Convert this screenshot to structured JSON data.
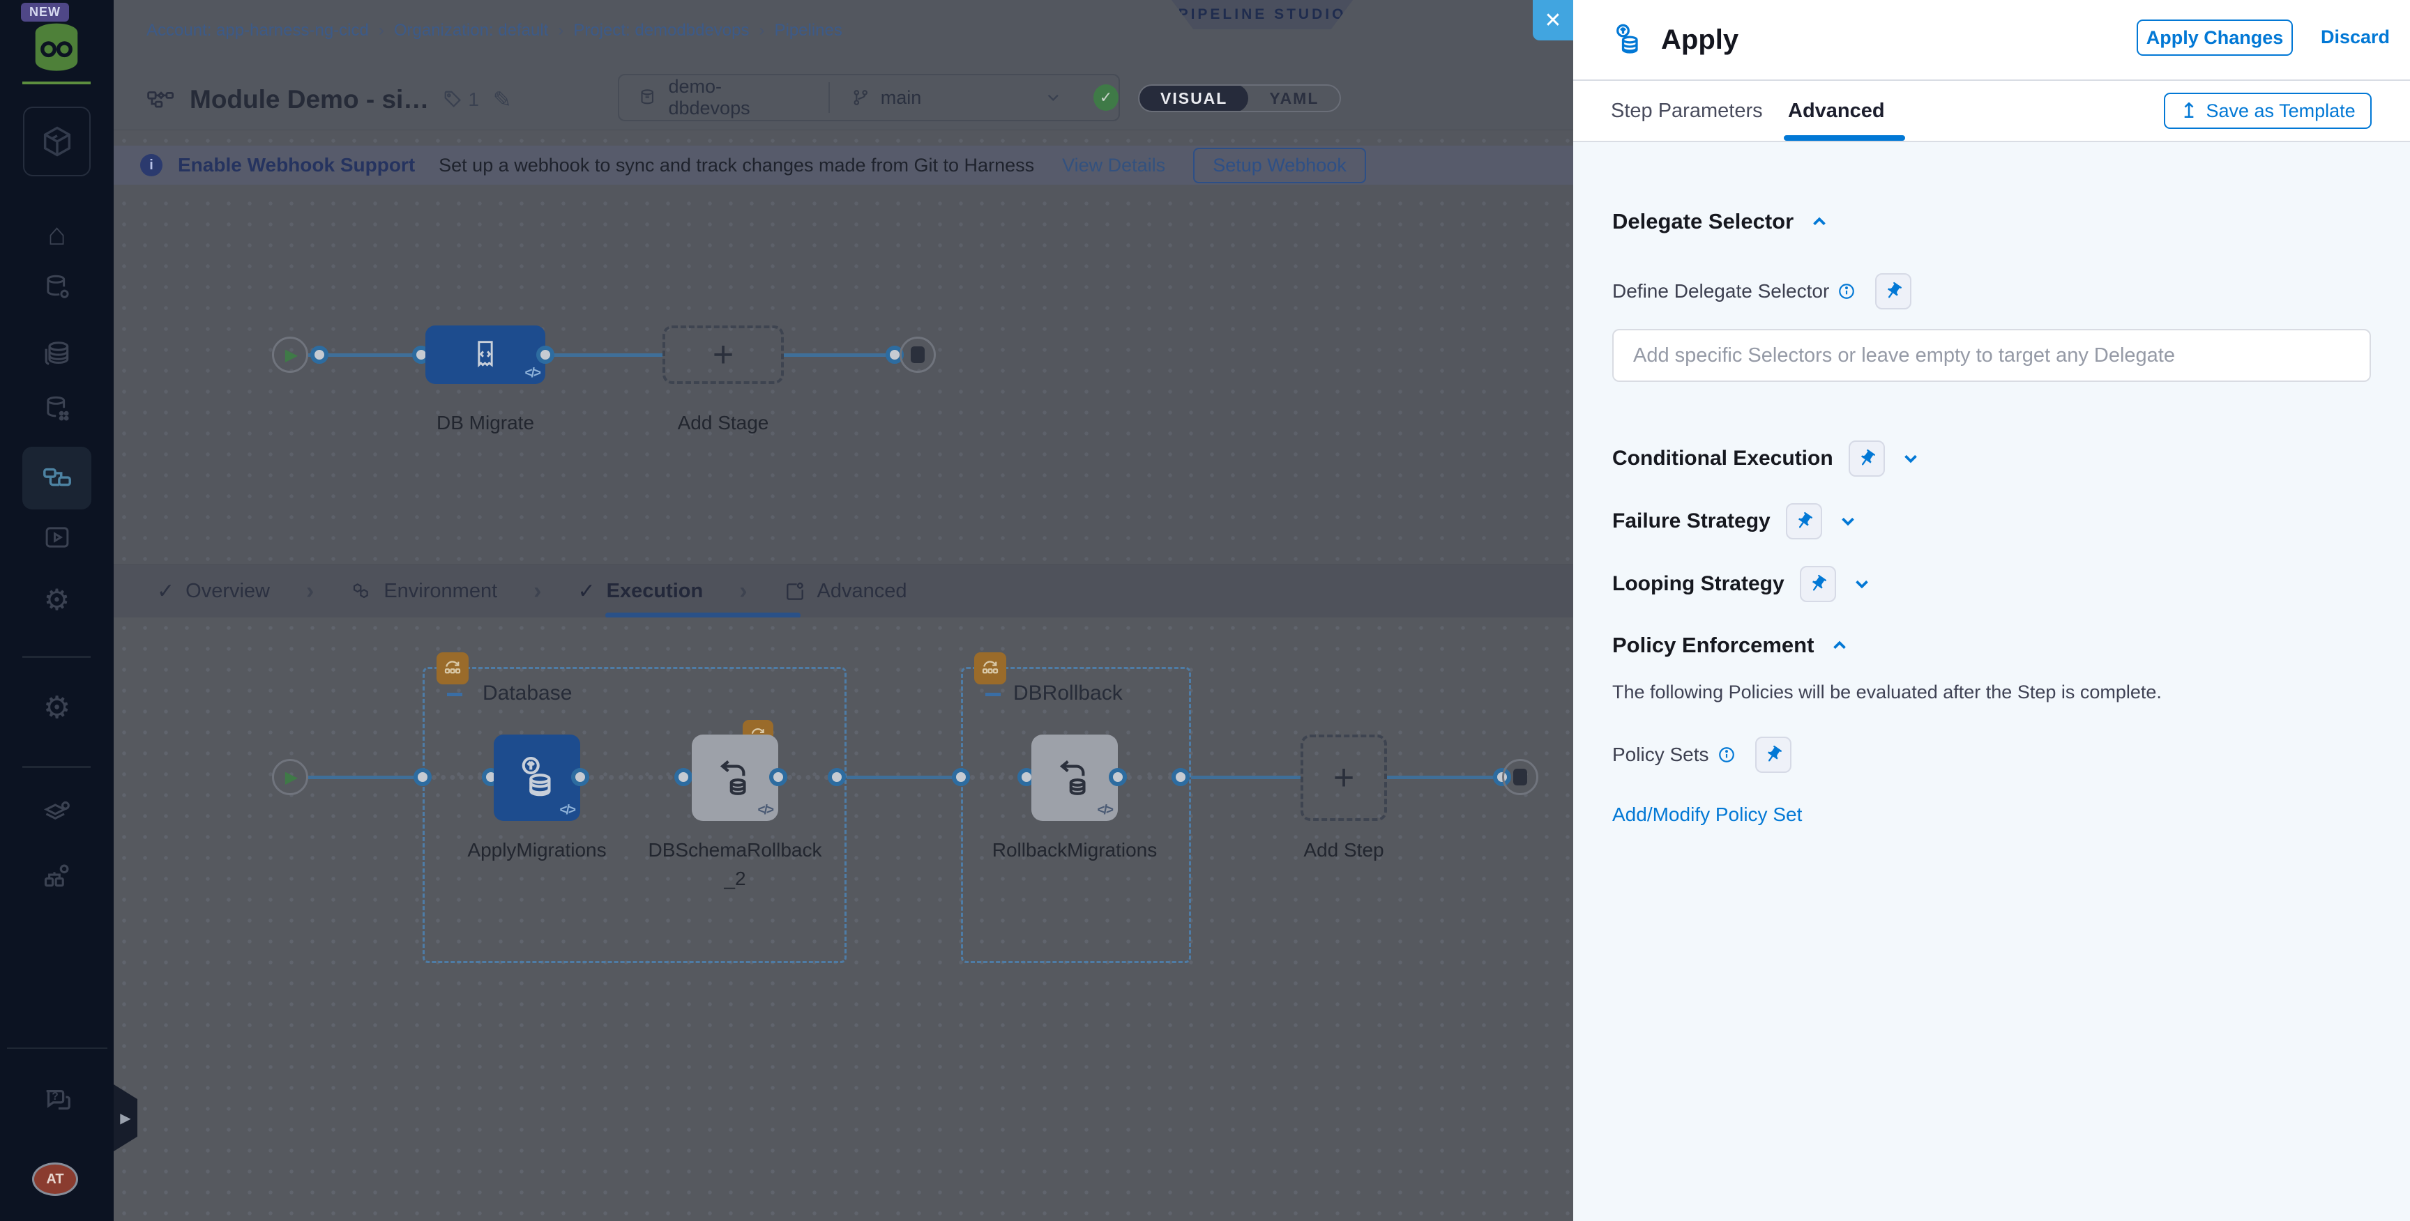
{
  "colors": {
    "accent": "#0278d5",
    "close_button": "#41a5e0",
    "node_blue": "#1d4c8e",
    "sidebar_bg": "#0c1322",
    "group_badge_orange": "#9a6b2a",
    "logo_green": "#4e8039",
    "success_green": "#3f7a47"
  },
  "icons": {
    "check": "✓",
    "chevron_sep": "›",
    "pencil": "✎",
    "play": "▶",
    "upload": "↥",
    "close": "✕",
    "plus": "+",
    "info": "i",
    "gear": "⚙",
    "home": "⌂",
    "code": "</>"
  },
  "sidebar": {
    "new_badge": "NEW",
    "avatar_initials": "AT"
  },
  "breadcrumb": {
    "items": [
      "Account: app-harness-ng-cicd",
      "Organization: default",
      "Project: demodbdevops",
      "Pipelines"
    ]
  },
  "studio_badge": "PIPELINE STUDIO",
  "title_bar": {
    "title": "Module Demo - si…",
    "tag_count": "1",
    "repo": "demo-dbdevops",
    "branch": "main",
    "visual_label": "VISUAL",
    "yaml_label": "YAML"
  },
  "webhook_banner": {
    "title": "Enable Webhook Support",
    "description": "Set up a webhook to sync and track changes made from Git to Harness",
    "view_details": "View Details",
    "setup_button": "Setup Webhook"
  },
  "stage_canvas": {
    "stage_label": "DB Migrate",
    "add_stage_label": "Add Stage"
  },
  "stage_tabs": {
    "overview": "Overview",
    "environment": "Environment",
    "execution": "Execution",
    "advanced": "Advanced"
  },
  "execution_canvas": {
    "groups": [
      {
        "name": "Database",
        "steps": [
          "ApplyMigrations",
          "DBSchemaRollback_2"
        ]
      },
      {
        "name": "DBRollback",
        "steps": [
          "RollbackMigrations"
        ]
      }
    ],
    "add_step_label": "Add Step"
  },
  "drawer": {
    "title": "Apply",
    "apply_changes": "Apply Changes",
    "discard": "Discard",
    "tabs": {
      "step_parameters": "Step Parameters",
      "advanced": "Advanced"
    },
    "save_as_template": "Save as Template",
    "sections": {
      "delegate": {
        "heading": "Delegate Selector",
        "label": "Define Delegate Selector",
        "placeholder": "Add specific Selectors or leave empty to target any Delegate"
      },
      "conditional": {
        "heading": "Conditional Execution"
      },
      "failure": {
        "heading": "Failure Strategy"
      },
      "looping": {
        "heading": "Looping Strategy"
      },
      "policy": {
        "heading": "Policy Enforcement",
        "description": "The following Policies will be evaluated after the Step is complete.",
        "sets_label": "Policy Sets",
        "add_link": "Add/Modify Policy Set"
      }
    }
  }
}
